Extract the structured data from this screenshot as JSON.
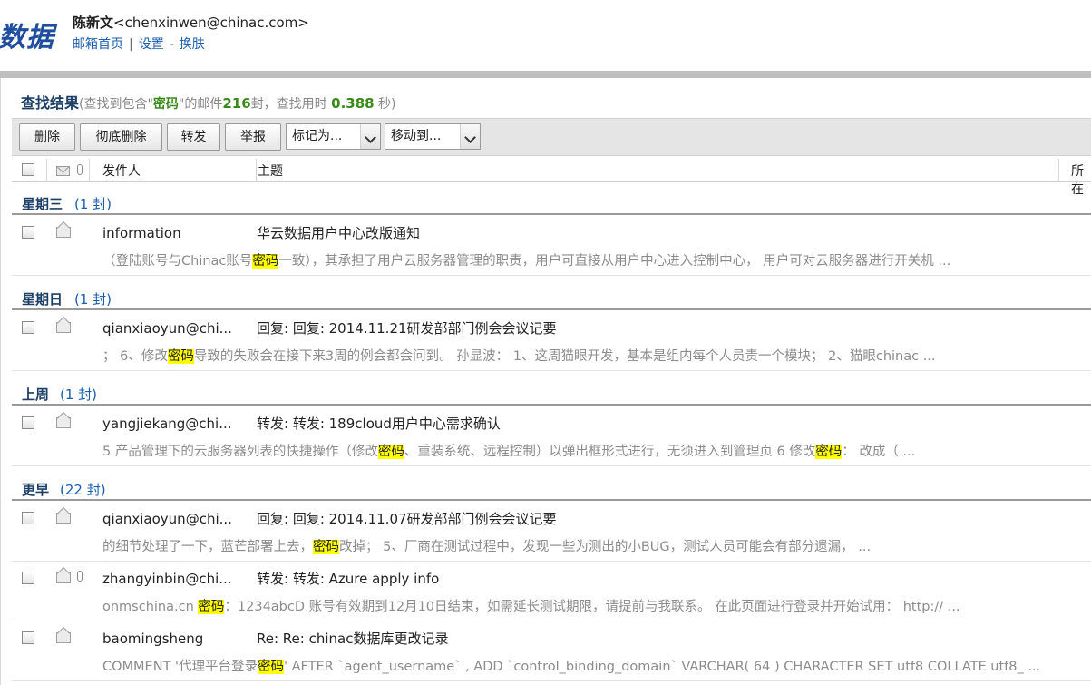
{
  "header": {
    "logo_text": "数据",
    "user_name": "陈新文",
    "user_email": "<chenxinwen@chinac.com>",
    "links": [
      "邮箱首页",
      "|",
      "设置",
      "-",
      "换肤"
    ]
  },
  "result": {
    "title": "查找结果",
    "prefix": "(查找到包含\"",
    "keyword": "密码",
    "mid": "\"的邮件",
    "count": "216",
    "unit": "封，查找用时",
    "time": "0.388",
    "suffix": "秒)"
  },
  "toolbar": {
    "delete": "删除",
    "delete_permanent": "彻底删除",
    "forward": "转发",
    "report": "举报",
    "mark_as": "标记为...",
    "move_to": "移动到..."
  },
  "columns": {
    "sender": "发件人",
    "subject": "主题",
    "folder": "所在"
  },
  "groups": [
    {
      "name": "星期三",
      "count": "(1 封)"
    },
    {
      "name": "星期日",
      "count": "(1 封)"
    },
    {
      "name": "上周",
      "count": "(1 封)"
    },
    {
      "name": "更早",
      "count": "(22 封)"
    }
  ],
  "mails": [
    {
      "sender": "information",
      "subject": "华云数据用户中心改版通知",
      "s1": "（登陆账号与Chinac账号",
      "k1": "密码",
      "s2": "一致），其承担了用户云服务器管理的职责，用户可直接从用户中心进入控制中心，  用户可对云服务器进行开关机 ...",
      "k2": "",
      "s3": ""
    },
    {
      "sender": "qianxiaoyun@chi...",
      "subject": "回复: 回复: 2014.11.21研发部部门例会会议记要",
      "s1": "；  6、修改",
      "k1": "密码",
      "s2": "导致的失败会在接下来3周的例会都会问到。  孙显波：  1、这周猫眼开发，基本是组内每个人员责一个模块；  2、猫眼chinac ...",
      "k2": "",
      "s3": ""
    },
    {
      "sender": "yangjiekang@chi...",
      "subject": "转发: 转发: 189cloud用户中心需求确认",
      "s1": "5 产品管理下的云服务器列表的快捷操作（修改",
      "k1": "密码",
      "s2": "、重装系统、远程控制）以弹出框形式进行，无须进入到管理页 6 修改",
      "k2": "密码",
      "s3": "：  改成（ ..."
    },
    {
      "sender": "qianxiaoyun@chi...",
      "subject": "回复: 回复: 2014.11.07研发部部门例会会议记要",
      "s1": "的细节处理了一下，蓝芒部署上去，",
      "k1": "密码",
      "s2": "改掉；  5、厂商在测试过程中，发现一些为测出的小BUG，测试人员可能会有部分遗漏，  ...",
      "k2": "",
      "s3": ""
    },
    {
      "sender": "zhangyinbin@chi...",
      "subject": "转发: 转发: Azure apply info",
      "s1": "onmschina.cn ",
      "k1": "密码",
      "s2": "：1234abcD 账号有效期到12月10日结束，如需延长测试期限，请提前与我联系。  在此页面进行登录并开始试用：  http:// ...",
      "k2": "",
      "s3": ""
    },
    {
      "sender": "baomingsheng",
      "subject": "Re: Re: chinac数据库更改记录",
      "s1": "COMMENT '代理平台登录",
      "k1": "密码",
      "s2": "' AFTER `agent_username` , ADD `control_binding_domain` VARCHAR( 64 ) CHARACTER SET utf8 COLLATE utf8_ ...",
      "k2": "",
      "s3": ""
    }
  ]
}
